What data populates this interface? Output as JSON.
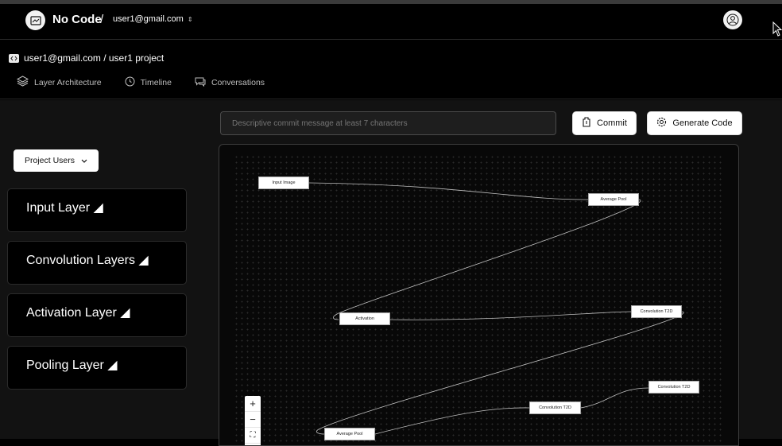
{
  "header": {
    "brand": "No Code",
    "separator": "/",
    "account": "user1@gmail.com",
    "account_chevron": "⌃",
    "icons": {
      "logo": "logo-icon",
      "profile": "user-icon",
      "cursor": "cursor-icon"
    }
  },
  "breadcrumb": {
    "text": "user1@gmail.com / user1 project",
    "icon": "code-icon"
  },
  "tabs": [
    {
      "label": "Layer Architecture",
      "icon": "layers-icon"
    },
    {
      "label": "Timeline",
      "icon": "clock-icon"
    },
    {
      "label": "Conversations",
      "icon": "chat-icon"
    }
  ],
  "toolbar": {
    "commit_placeholder": "Descriptive commit message at least 7 characters",
    "commit_label": "Commit",
    "generate_label": "Generate Code"
  },
  "sidebar": {
    "users_button": "Project Users",
    "layers": [
      {
        "label": "Input Layer ◢"
      },
      {
        "label": "Convolution Layers ◢"
      },
      {
        "label": "Activation Layer ◢"
      },
      {
        "label": "Pooling Layer ◢"
      }
    ]
  },
  "graph": {
    "nodes": [
      {
        "label": "Input Image"
      },
      {
        "label": "Average Pool"
      },
      {
        "label": "Activation"
      },
      {
        "label": "Convolution T2D"
      },
      {
        "label": "Convolution T2D"
      },
      {
        "label": "Convolution T2D"
      },
      {
        "label": "Average Pool"
      }
    ]
  },
  "zoom_controls": {
    "zoom_in": "+",
    "zoom_out": "−",
    "fit": "⛶"
  },
  "colors": {
    "accent_error": "#e34a4a",
    "background": "#000000",
    "panel": "#121212"
  }
}
